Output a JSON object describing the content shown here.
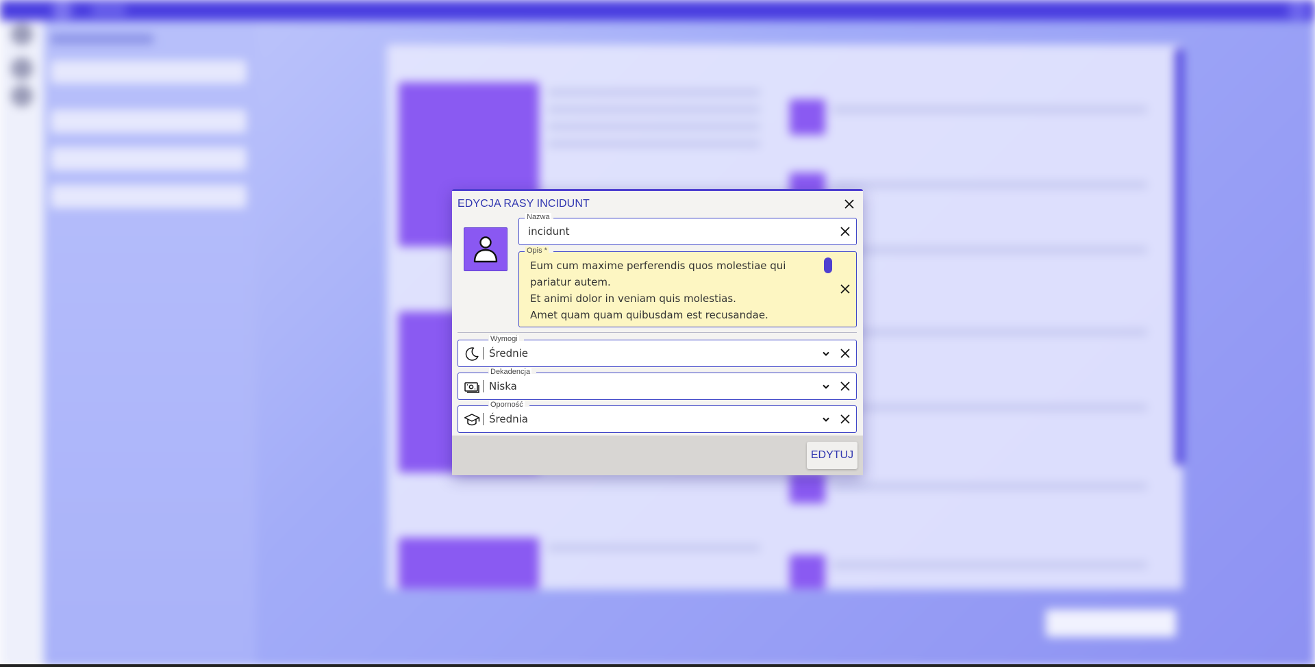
{
  "dialog": {
    "title": "EDYCJA RASY INCIDUNT",
    "avatar_icon": "user-icon",
    "name_field": {
      "label": "Nazwa",
      "value": "incidunt"
    },
    "description_field": {
      "label": "Opis *",
      "lines": [
        "Eum cum maxime perferendis quos molestiae qui",
        "pariatur autem.",
        "Et animi dolor in veniam quis molestias.",
        "Amet quam quam quibusdam est recusandae."
      ]
    },
    "selects": [
      {
        "label": "Wymogi",
        "value": "Średnie",
        "icon": "moon-icon"
      },
      {
        "label": "Dekadencja",
        "value": "Niska",
        "icon": "money-icon"
      },
      {
        "label": "Oporność",
        "value": "Średnia",
        "icon": "graduation-cap-icon"
      }
    ],
    "submit_label": "EDYTUJ"
  },
  "colors": {
    "accent": "#4e3fd0",
    "title_text": "#2f35b0",
    "avatar_bg": "#8a58f2",
    "description_bg": "#fdf6c2",
    "topbar": "#4a3ee0"
  }
}
